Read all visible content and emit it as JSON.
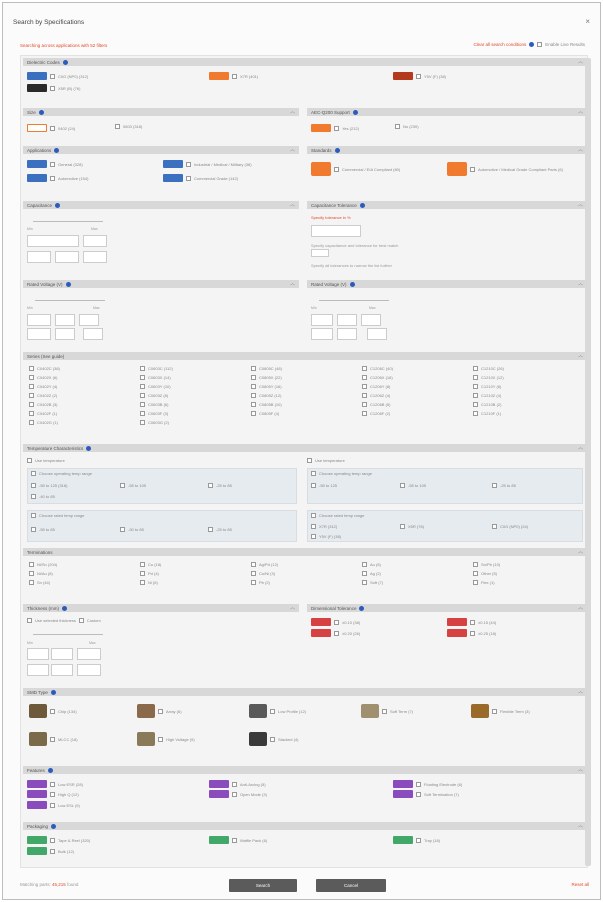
{
  "dialog": {
    "title": "Search by Specifications",
    "close_glyph": "×"
  },
  "notice": "Searching across applications with 52 filters",
  "top_right": {
    "link": "Clear all search conditions",
    "checkbox_label": "Enable Live Results"
  },
  "colors": {
    "accent": "#e04a2a",
    "info_dot": "#2d5bbd",
    "header_bg": "#d8d8d8"
  },
  "s1": {
    "title": "Dielectric Codes",
    "items": [
      {
        "label": "C0G (NP0)  (312)"
      },
      {
        "label": "X7R  (401)"
      },
      {
        "label": "Y5V (F) (38)"
      },
      {
        "label": "X5R (B)  (76)"
      }
    ]
  },
  "s2": {
    "title": "Size",
    "items": [
      {
        "label": "0402  (24)"
      },
      {
        "label": "0603  (318)"
      }
    ]
  },
  "s3": {
    "title": "AEC-Q200 Support",
    "items": [
      {
        "label": "Yes  (212)"
      },
      {
        "label": "No  (230)"
      }
    ]
  },
  "s4": {
    "title": "Applications",
    "items": [
      {
        "label": "General  (328)"
      },
      {
        "label": "Automotive  (154)"
      },
      {
        "label": "Industrial / Medical / Military  (38)"
      },
      {
        "label": "Commercial Grade  (142)"
      }
    ]
  },
  "s5": {
    "title": "Standards",
    "items": [
      {
        "label": "Commercial / EIA Compliant  (80)"
      },
      {
        "label": "Automotive / Medical Grade Compliant Parts  (6)"
      }
    ]
  },
  "s6": {
    "title": "Capacitance",
    "lbl_min": "Min",
    "lbl_max": "Max"
  },
  "s7": {
    "title": "Capacitance Tolerance",
    "line1": "Specify tolerance in %",
    "line2": "Specify capacitance and tolerance for best match",
    "line3": "Specify all tolerances to narrow the list further"
  },
  "s8": {
    "title": "Rated Voltage (V)",
    "lbl_min": "Min",
    "lbl_max": "Max"
  },
  "s9": {
    "title": "Rated Voltage (V)",
    "lbl_min": "Min",
    "lbl_max": "Max"
  },
  "s10": {
    "title": "Series (See guide)",
    "items": [
      "C0402C (38)",
      "C0603C (112)",
      "C0805C (48)",
      "C1206C (40)",
      "C1210C (26)",
      "C0402X (6)",
      "C0603X (14)",
      "C0805X (22)",
      "C1206X (18)",
      "C1210X (12)",
      "C0402Y (4)",
      "C0603Y (10)",
      "C0805Y (16)",
      "C1206Y (8)",
      "C1210Y (6)",
      "C0402Z (2)",
      "C0603Z (8)",
      "C0805Z (12)",
      "C1206Z (4)",
      "C1210Z (4)",
      "C0402B (3)",
      "C0603B (6)",
      "C0805B (10)",
      "C1206B (5)",
      "C1210B (2)",
      "C0402F (1)",
      "C0603F (3)",
      "C0805F (4)",
      "C1206F (2)",
      "C1210F (1)",
      "C0402G (1)",
      "C0603G (2)"
    ]
  },
  "s11": {
    "title": "Temperature Characteristics",
    "left": {
      "cb1": "Use temperature",
      "cb2": "Choose operating temp range",
      "r1": [
        "-55 to 125  (318)",
        "-55 to 105",
        "-25 to 85"
      ],
      "r1b": [
        "-40 to 85"
      ],
      "cb3": "Choose rated temp range",
      "r2": [
        "-55 to 85",
        "-30 to 85",
        "-25 to 85"
      ]
    },
    "right": {
      "cb1": "Use temperature",
      "cb2": "Choose operating temp range",
      "r1": [
        "-55 to 125",
        "-55 to 105",
        "-25 to 85"
      ],
      "cb3": "Choose rated temp range",
      "r2": [
        "X7R  (312)",
        "X5R  (76)",
        "C0G (NP0)  (24)"
      ],
      "r2b": [
        "Y5V (F)  (38)"
      ]
    }
  },
  "s12": {
    "title": "Terminations",
    "items": [
      "Ni/Sn (204)",
      "Cu (18)",
      "Ag/Pd (12)",
      "Au (6)",
      "Sn/Pb (10)",
      "Ni/Au (8)",
      "Pd (4)",
      "Cu/Ni (3)",
      "Ag (2)",
      "Other (5)",
      "Sn (44)",
      "Ni (6)",
      "Pb (2)",
      "Soft (7)",
      "Flex (1)"
    ]
  },
  "s13": {
    "title": "Thickness (mm)",
    "cb1": "Use selected thickness",
    "cb2": "Custom",
    "lbl_min": "Min",
    "lbl_max": "Max"
  },
  "s14": {
    "title": "Dimensional Tolerance",
    "items": [
      "±0.10  (38)",
      "±0.15  (44)",
      "±0.20  (26)",
      "±0.25  (18)"
    ]
  },
  "s15": {
    "title": "SMD Type",
    "items": [
      "Chip  (134)",
      "Array  (6)",
      "Low Profile  (12)",
      "Soft Term  (7)",
      "Flexible Term  (3)",
      "MLCC  (18)",
      "High Voltage  (9)",
      "Stacked  (4)"
    ]
  },
  "s16": {
    "title": "Features",
    "items": [
      "Low ESR  (28)",
      "High Q  (12)",
      "Low ESL  (9)",
      "Anti-Arcing  (5)",
      "Open Mode  (3)",
      "Floating Electrode  (6)",
      "Soft Termination  (7)"
    ]
  },
  "s17": {
    "title": "Packaging",
    "items": [
      "Tape & Reel  (320)",
      "Bulk  (12)",
      "Waffle Pack  (6)",
      "Tray  (18)"
    ]
  },
  "footer": {
    "result_prefix": "Matching parts:",
    "result_count": "45,215",
    "result_suffix": "found",
    "search_label": "Search",
    "cancel_label": "Cancel",
    "reset_label": "Reset all"
  }
}
